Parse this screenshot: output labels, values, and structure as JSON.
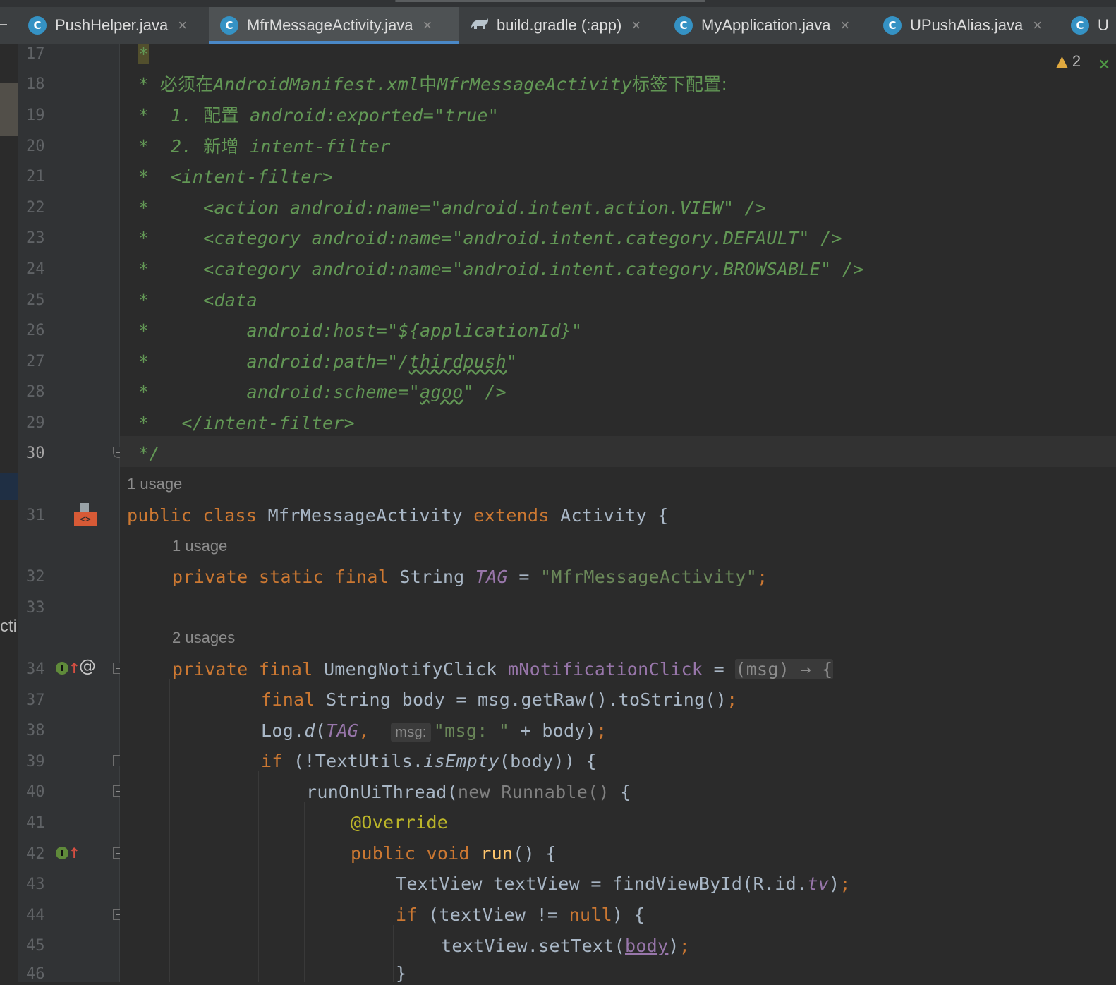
{
  "tabs": [
    {
      "label": "PushHelper.java",
      "icon": "class-icon",
      "active": false
    },
    {
      "label": "MfrMessageActivity.java",
      "icon": "class-icon",
      "active": true
    },
    {
      "label": "build.gradle (:app)",
      "icon": "gradle-icon",
      "active": false
    },
    {
      "label": "MyApplication.java",
      "icon": "class-icon",
      "active": false
    },
    {
      "label": "UPushAlias.java",
      "icon": "class-icon",
      "active": false
    },
    {
      "label": "U",
      "icon": "class-icon",
      "active": false
    }
  ],
  "class_icon_letter": "C",
  "inspections": {
    "warning_count": "2"
  },
  "side_panel_fragment": "cti",
  "line_numbers": [
    "17",
    "18",
    "19",
    "20",
    "21",
    "22",
    "23",
    "24",
    "25",
    "26",
    "27",
    "28",
    "29",
    "30",
    "31",
    "32",
    "33",
    "34",
    "37",
    "38",
    "39",
    "40",
    "41",
    "42",
    "43",
    "44",
    "45",
    "46"
  ],
  "usages": {
    "class": "1 usage",
    "tag": "1 usage",
    "click": "2 usages"
  },
  "code": {
    "l17": "*",
    "l18a": "* ",
    "l18b": "必须在",
    "l18c": "AndroidManifest.xml",
    "l18d": "中",
    "l18e": "MfrMessageActivity",
    "l18f": "标签下配置:",
    "l19a": "*  1. ",
    "l19b": "配置",
    "l19c": " android:exported=\"true\"",
    "l20a": "*  2. ",
    "l20b": "新增",
    "l20c": " intent-filter",
    "l21": "*  <intent-filter>",
    "l22": "*     <action android:name=\"android.intent.action.VIEW\" />",
    "l23": "*     <category android:name=\"android.intent.category.DEFAULT\" />",
    "l24": "*     <category android:name=\"android.intent.category.BROWSABLE\" />",
    "l25": "*     <data",
    "l26": "*         android:host=\"${applicationId}\"",
    "l27a": "*         android:path=\"/",
    "l27b": "thirdpush",
    "l27c": "\"",
    "l28a": "*         android:scheme=\"",
    "l28b": "agoo",
    "l28c": "\" />",
    "l29": "*   </intent-filter>",
    "l30": "*/",
    "l31_public": "public",
    "l31_class": "class",
    "l31_name": "MfrMessageActivity",
    "l31_extends": "extends",
    "l31_super": "Activity",
    "l31_brace": "{",
    "l32_private": "private",
    "l32_static": "static",
    "l32_final": "final",
    "l32_type": "String",
    "l32_field": "TAG",
    "l32_eq": "=",
    "l32_value": "\"MfrMessageActivity\"",
    "l32_semi": ";",
    "l34_private": "private",
    "l34_final": "final",
    "l34_type": "UmengNotifyClick",
    "l34_field": "mNotificationClick",
    "l34_eq": "=",
    "l34_lambda": "(msg) → {",
    "l37_final": "final",
    "l37_type": "String",
    "l37_rest": "body = msg.getRaw().toString()",
    "l37_semi": ";",
    "l38_log": "Log.",
    "l38_d": "d",
    "l38_open": "(",
    "l38_tag": "TAG",
    "l38_comma": ",",
    "l38_hint": "msg:",
    "l38_str": "\"msg: \"",
    "l38_rest": " + body)",
    "l38_semi": ";",
    "l39_if": "if",
    "l39_open": " (!TextUtils.",
    "l39_method": "isEmpty",
    "l39_rest": "(body)) {",
    "l40_call": "runOnUiThread(",
    "l40_new": "new Runnable()",
    "l40_rest": " {",
    "l41": "@Override",
    "l42_public": "public",
    "l42_void": "void",
    "l42_method": "run",
    "l42_rest": "() {",
    "l43_a": "TextView textView = findViewById(R.id.",
    "l43_field": "tv",
    "l43_b": ")",
    "l43_semi": ";",
    "l44_if": "if",
    "l44_a": " (textView != ",
    "l44_null": "null",
    "l44_b": ") {",
    "l45_a": "textView.setText(",
    "l45_body": "body",
    "l45_b": ")",
    "l45_semi": ";",
    "l46": "}"
  },
  "colors": {
    "accent": "#4a88c7",
    "background": "#2b2b2b",
    "keyword": "#cc7832",
    "string": "#6a8759",
    "doc_comment": "#629755",
    "field": "#9876aa",
    "method": "#ffc66d"
  }
}
